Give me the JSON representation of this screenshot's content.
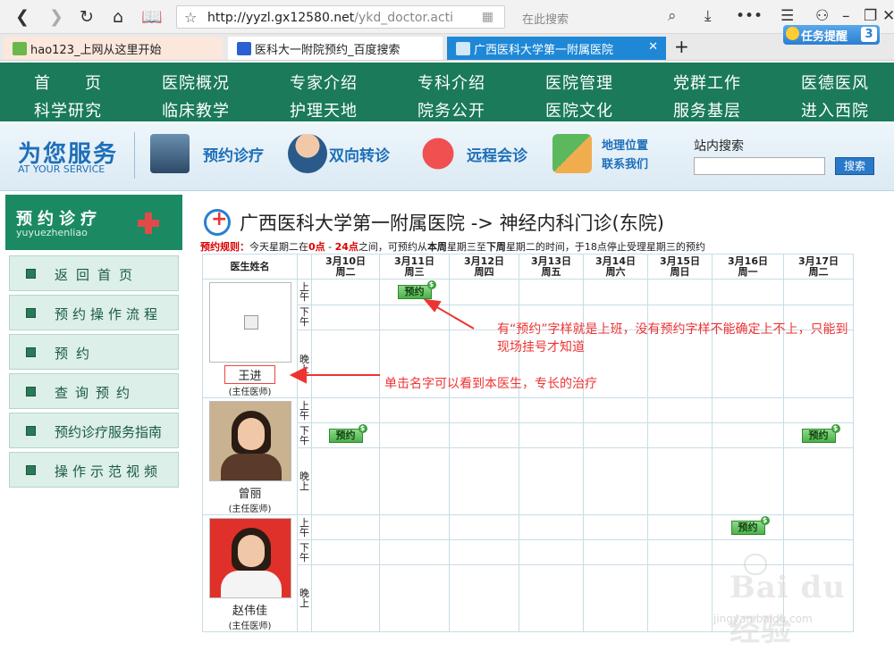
{
  "browser": {
    "url_main": "http://yyzl.gx12580.net",
    "url_path": "/ykd_doctor.actio",
    "search_placeholder": "在此搜索",
    "tabs": [
      {
        "label": "hao123_上网从这里开始"
      },
      {
        "label": "医科大一附院预约_百度搜索"
      },
      {
        "label": "广西医科大学第一附属医院"
      }
    ],
    "task_reminder": "任务提醒",
    "task_count": "3"
  },
  "nav": {
    "row1": [
      "首　　页",
      "医院概况",
      "专家介绍",
      "专科介绍",
      "医院管理",
      "党群工作",
      "医德医风"
    ],
    "row2": [
      "科学研究",
      "临床教学",
      "护理天地",
      "院务公开",
      "医院文化",
      "服务基层",
      "进入西院"
    ]
  },
  "service": {
    "title": "为您服务",
    "subtitle": "AT YOUR SERVICE",
    "items": [
      "预约诊疗",
      "双向转诊",
      "远程会诊"
    ],
    "geo": "地理位置",
    "contact": "联系我们",
    "site_search_label": "站内搜索",
    "search_btn": "搜索"
  },
  "sidebar": {
    "title": "预约诊疗",
    "pinyin": "yuyuezhenliao",
    "items": [
      "返回首页",
      "预约操作流程",
      "预约",
      "查询预约",
      "预约诊疗服务指南",
      "操作示范视频"
    ]
  },
  "content": {
    "hospital": "广西医科大学第一附属医院",
    "arrow": "->",
    "department": "神经内科门诊(东院)",
    "rule_label": "预约规则：",
    "rule_a": "今天星期二在",
    "rule_b": "0点",
    "rule_c": " - ",
    "rule_d": "24点",
    "rule_e": "之间，可预约从",
    "rule_f": "本周",
    "rule_g": "星期三至",
    "rule_h": "下周",
    "rule_i": "星期二的时间，于18点停止受理星期三的预约"
  },
  "schedule": {
    "doctor_col": "医生姓名",
    "days": [
      {
        "date": "3月10日",
        "weekday": "周二"
      },
      {
        "date": "3月11日",
        "weekday": "周三"
      },
      {
        "date": "3月12日",
        "weekday": "周四"
      },
      {
        "date": "3月13日",
        "weekday": "周五"
      },
      {
        "date": "3月14日",
        "weekday": "周六"
      },
      {
        "date": "3月15日",
        "weekday": "周日"
      },
      {
        "date": "3月16日",
        "weekday": "周一"
      },
      {
        "date": "3月17日",
        "weekday": "周二"
      }
    ],
    "slots": {
      "am": "上午",
      "pm": "下午",
      "eve": "晚上"
    },
    "book_label": "预约",
    "doctors": [
      {
        "name": "王进",
        "title": "(主任医师)"
      },
      {
        "name": "曾丽",
        "title": "(主任医师)"
      },
      {
        "name": "赵伟佳",
        "title": "(主任医师)"
      }
    ]
  },
  "annotations": {
    "note1_line1": "有“预约”字样就是上班，没有预约字样不能确定上不上，只能到",
    "note1_line2": "现场挂号才知道",
    "note2": "单击名字可以看到本医生，专长的治疗",
    "color": "#e33333"
  },
  "watermark": {
    "text": "Bai du 经验",
    "sub": "jingyan.baidu.com"
  }
}
